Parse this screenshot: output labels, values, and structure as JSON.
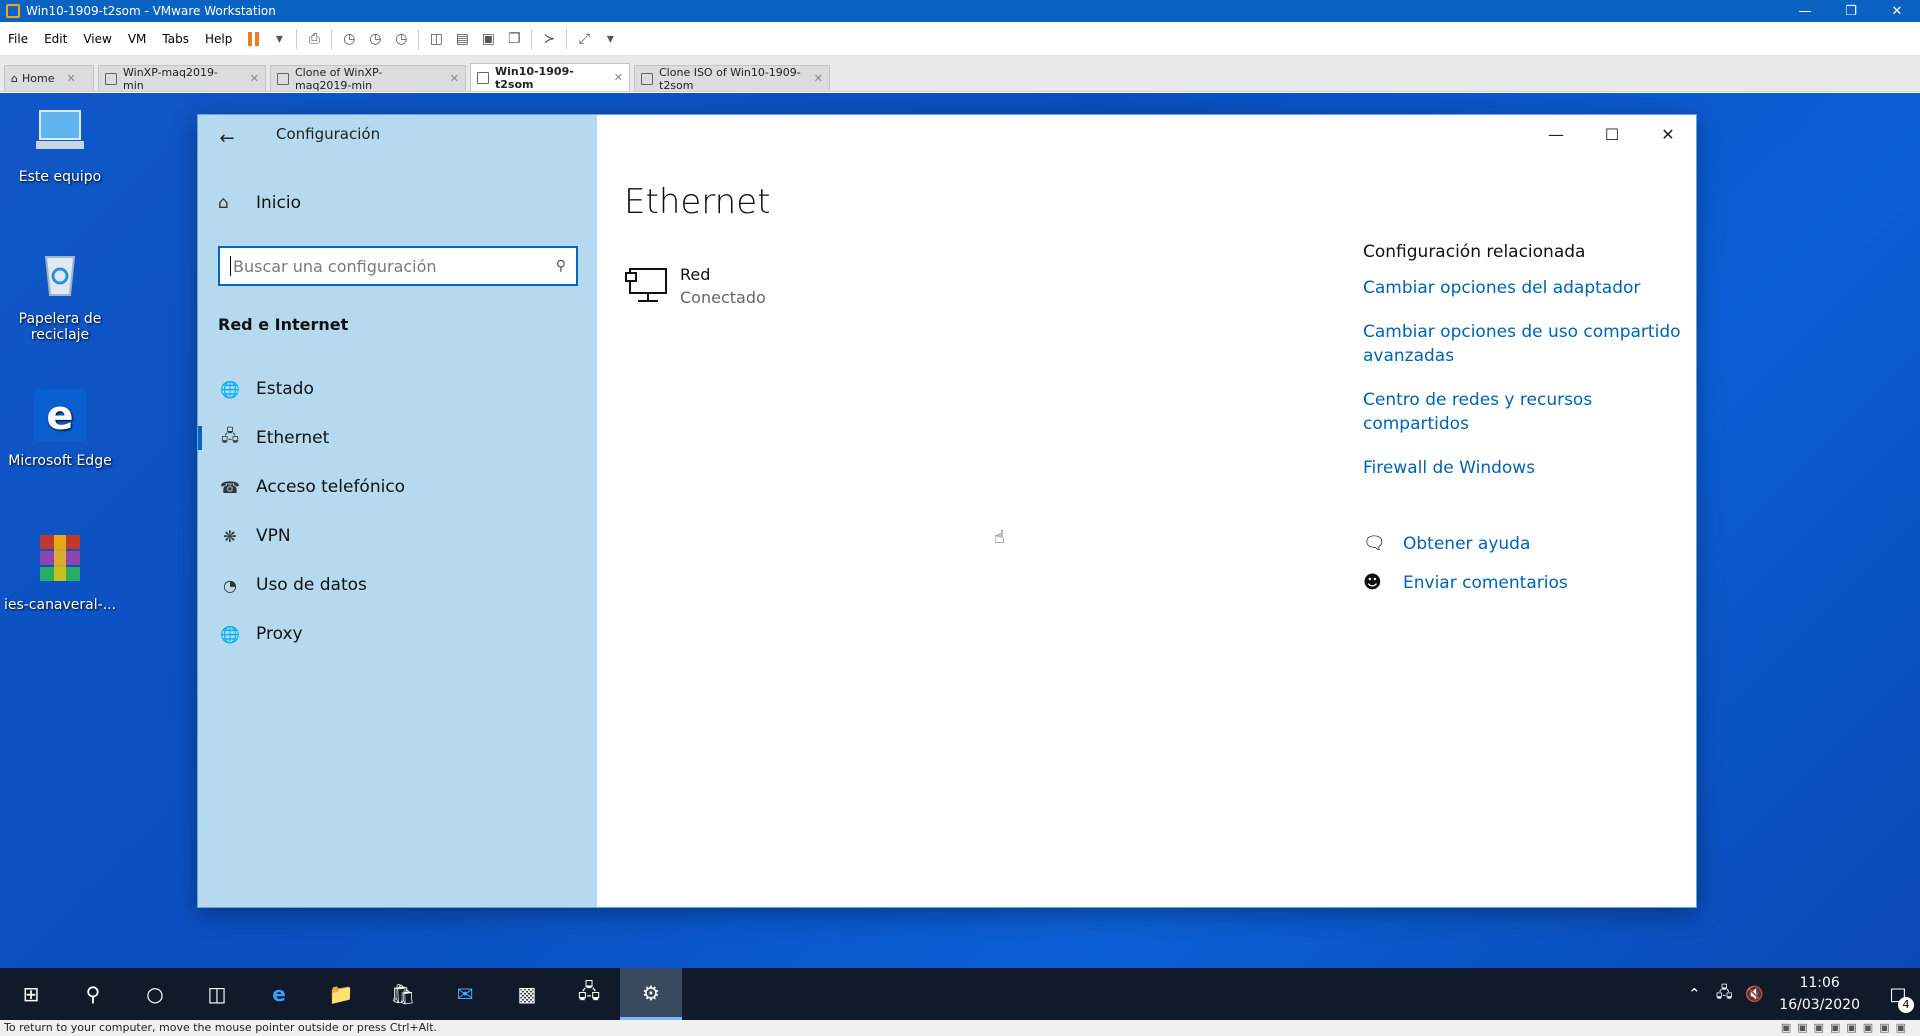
{
  "vmware": {
    "title": "Win10-1909-t2som - VMware Workstation",
    "menus": [
      "File",
      "Edit",
      "View",
      "VM",
      "Tabs",
      "Help"
    ],
    "tabs": [
      {
        "label": "Home",
        "active": false
      },
      {
        "label": "WinXP-maq2019-min",
        "active": false
      },
      {
        "label": "Clone of WinXP-maq2019-min",
        "active": false
      },
      {
        "label": "Win10-1909-t2som",
        "active": true
      },
      {
        "label": "Clone ISO of Win10-1909-t2som",
        "active": false
      }
    ],
    "status_text": "To return to your computer, move the mouse pointer outside or press Ctrl+Alt."
  },
  "desktop": {
    "icons": [
      {
        "label": "Este equipo",
        "icon": "computer-icon"
      },
      {
        "label": "Papelera de reciclaje",
        "icon": "recycle-bin-icon"
      },
      {
        "label": "Microsoft Edge",
        "icon": "edge-icon"
      },
      {
        "label": "ies-canaveral-...",
        "icon": "winrar-icon"
      }
    ]
  },
  "settings": {
    "app_title": "Configuración",
    "home_label": "Inicio",
    "search_placeholder": "Buscar una configuración",
    "section_title": "Red e Internet",
    "nav": [
      {
        "label": "Estado",
        "icon": "globe-status-icon",
        "selected": false
      },
      {
        "label": "Ethernet",
        "icon": "ethernet-icon",
        "selected": true
      },
      {
        "label": "Acceso telefónico",
        "icon": "dialup-icon",
        "selected": false
      },
      {
        "label": "VPN",
        "icon": "vpn-icon",
        "selected": false
      },
      {
        "label": "Uso de datos",
        "icon": "data-usage-icon",
        "selected": false
      },
      {
        "label": "Proxy",
        "icon": "globe-icon",
        "selected": false
      }
    ],
    "page_title": "Ethernet",
    "network": {
      "name": "Red",
      "status": "Conectado"
    },
    "related": {
      "title": "Configuración relacionada",
      "links": [
        "Cambiar opciones del adaptador",
        "Cambiar opciones de uso compartido avanzadas",
        "Centro de redes y recursos compartidos",
        "Firewall de Windows"
      ]
    },
    "help": {
      "get_help": "Obtener ayuda",
      "feedback": "Enviar comentarios"
    }
  },
  "taskbar": {
    "time": "11:06",
    "date": "16/03/2020",
    "notification_count": "4"
  },
  "colors": {
    "accent": "#0067c0",
    "sidebar_bg": "#b5daf0",
    "link": "#0063b1",
    "taskbar_bg": "#101a2b",
    "vmware_titlebar": "#0a63c2"
  }
}
